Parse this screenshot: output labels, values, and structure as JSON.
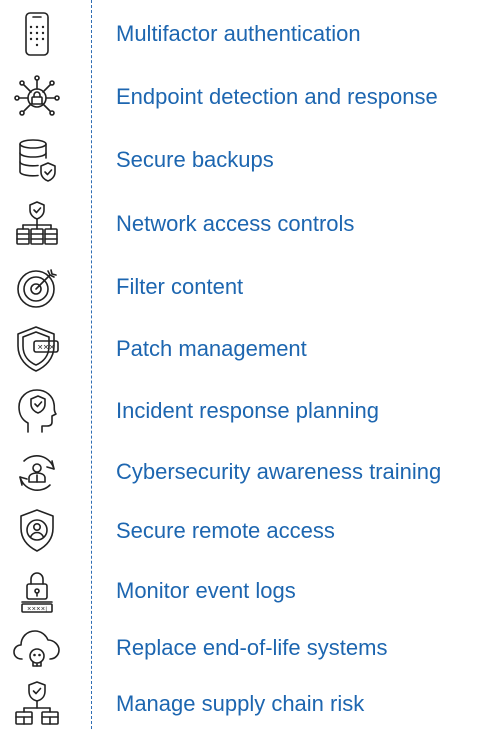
{
  "items": [
    {
      "label": "Multifactor authentication",
      "icon": "phone-keypad-icon"
    },
    {
      "label": "Endpoint detection and response",
      "icon": "network-lock-icon"
    },
    {
      "label": "Secure backups",
      "icon": "database-shield-icon"
    },
    {
      "label": "Network access controls",
      "icon": "network-hierarchy-shield-icon"
    },
    {
      "label": "Filter content",
      "icon": "target-arrow-icon"
    },
    {
      "label": "Patch management",
      "icon": "shield-password-icon"
    },
    {
      "label": "Incident response planning",
      "icon": "head-shield-icon"
    },
    {
      "label": "Cybersecurity awareness training",
      "icon": "user-cycle-icon"
    },
    {
      "label": "Secure remote access",
      "icon": "shield-user-icon"
    },
    {
      "label": "Monitor event logs",
      "icon": "lock-password-icon"
    },
    {
      "label": "Replace end-of-life systems",
      "icon": "cloud-skull-icon"
    },
    {
      "label": "Manage supply chain risk",
      "icon": "shield-network-icon"
    }
  ],
  "colors": {
    "label": "#1d66b0",
    "divider": "#2f6db3",
    "icon": "#222222"
  }
}
